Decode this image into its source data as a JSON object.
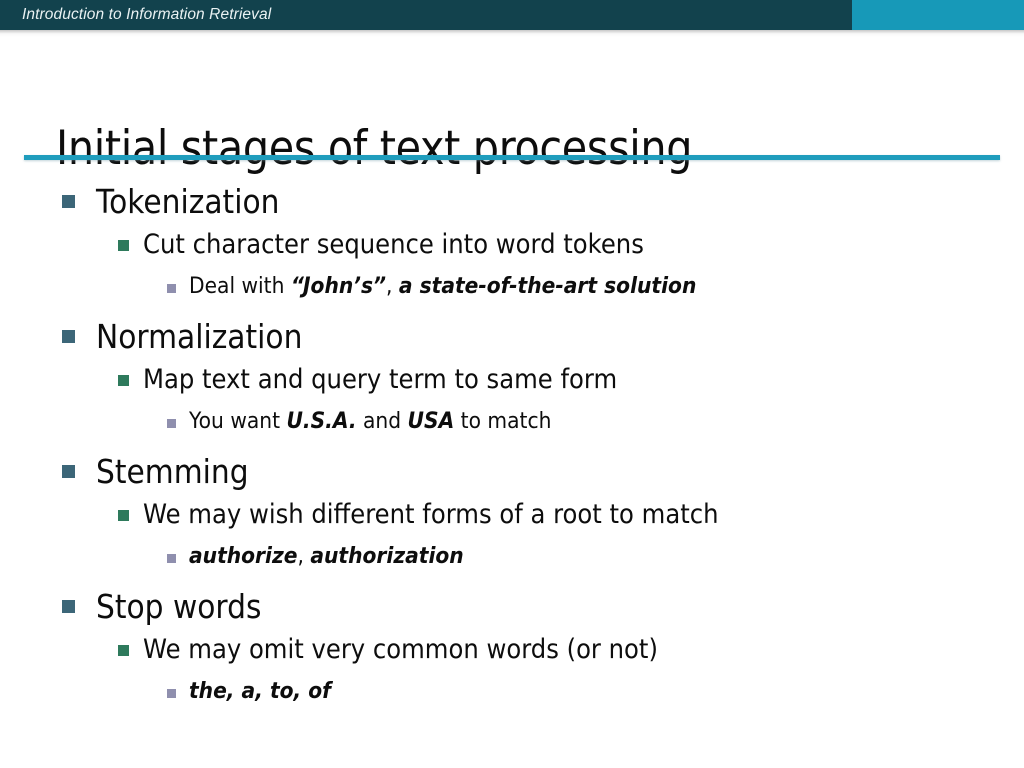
{
  "header": {
    "course_title": "Introduction to Information Retrieval",
    "dark_color": "#12424d",
    "accent_color": "#1799b8"
  },
  "slide": {
    "title": "Initial stages of text processing",
    "rule_color": "#1f9dbd"
  },
  "bullets": {
    "marker_colors": {
      "level1": "#3c6678",
      "level2": "#2e7a5c",
      "level3": "#8f8fae"
    },
    "items": [
      {
        "level": 1,
        "text": "Tokenization"
      },
      {
        "level": 2,
        "text": "Cut character sequence into word tokens"
      },
      {
        "level": 3,
        "segments": [
          {
            "text": "Deal with ",
            "emphasis": false
          },
          {
            "text": "“John’s”",
            "emphasis": true
          },
          {
            "text": ", ",
            "emphasis": false
          },
          {
            "text": "a state-of-the-art solution",
            "emphasis": true
          }
        ]
      },
      {
        "level": 1,
        "text": "Normalization"
      },
      {
        "level": 2,
        "text": "Map text and query term to same form"
      },
      {
        "level": 3,
        "segments": [
          {
            "text": "You want ",
            "emphasis": false
          },
          {
            "text": "U.S.A.",
            "emphasis": true
          },
          {
            "text": " and ",
            "emphasis": false
          },
          {
            "text": "USA",
            "emphasis": true
          },
          {
            "text": " to match",
            "emphasis": false
          }
        ]
      },
      {
        "level": 1,
        "text": "Stemming"
      },
      {
        "level": 2,
        "text": "We may wish different forms of a root to match"
      },
      {
        "level": 3,
        "segments": [
          {
            "text": "authorize",
            "emphasis": true
          },
          {
            "text": ", ",
            "emphasis": false
          },
          {
            "text": "authorization",
            "emphasis": true
          }
        ]
      },
      {
        "level": 1,
        "text": "Stop words"
      },
      {
        "level": 2,
        "text": "We may omit very common words (or not)"
      },
      {
        "level": 3,
        "segments": [
          {
            "text": "the, a, to, of",
            "emphasis": true
          }
        ]
      }
    ]
  }
}
